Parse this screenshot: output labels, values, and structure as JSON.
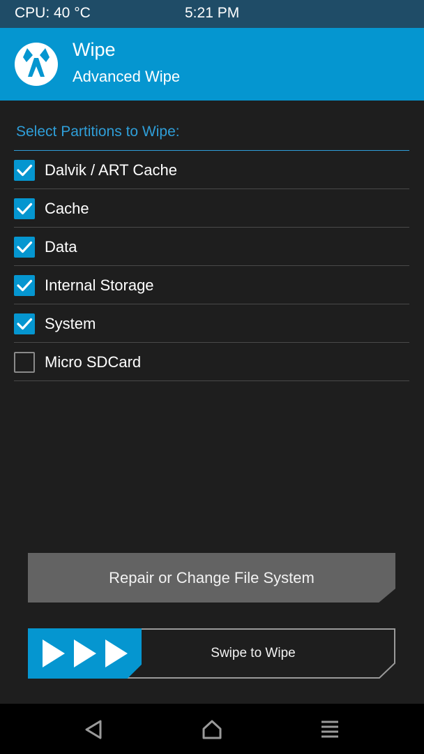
{
  "status_bar": {
    "cpu": "CPU: 40 °C",
    "time": "5:21 PM"
  },
  "header": {
    "title": "Wipe",
    "subtitle": "Advanced Wipe",
    "logo_icon": "twrp-logo-icon"
  },
  "section": {
    "title": "Select Partitions to Wipe:"
  },
  "partitions": [
    {
      "label": "Dalvik / ART Cache",
      "checked": true
    },
    {
      "label": "Cache",
      "checked": true
    },
    {
      "label": "Data",
      "checked": true
    },
    {
      "label": "Internal Storage",
      "checked": true
    },
    {
      "label": "System",
      "checked": true
    },
    {
      "label": "Micro SDCard",
      "checked": false
    }
  ],
  "buttons": {
    "repair": "Repair or Change File System",
    "swipe": "Swipe to Wipe"
  },
  "navbar": {
    "back_icon": "back-icon",
    "home_icon": "home-icon",
    "menu_icon": "menu-icon"
  },
  "colors": {
    "accent": "#0596d0",
    "status_bar": "#1f4c67",
    "background": "#1e1e1e",
    "button_gray": "#636363"
  }
}
